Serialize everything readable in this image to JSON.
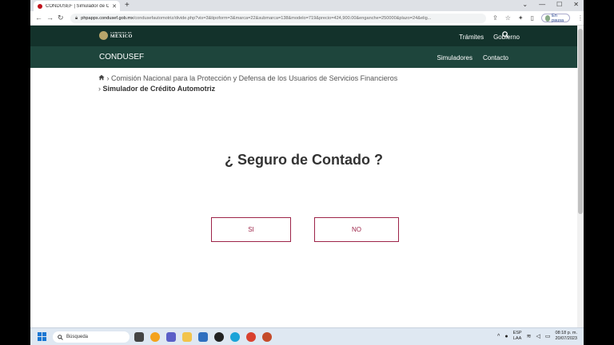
{
  "browser": {
    "tab_title": "CONDUSEF | Simulador de Cré",
    "tab_close": "✕",
    "new_tab": "+",
    "url_domain": "phpapps.condusef.gob.mx",
    "url_rest": "/condusefautomotriz/divide.php?vis=3&tipoform=3&marca=22&submarca=138&modelo=719&precio=424,900.00&enganche=250000&plazo=24&elig...",
    "incognito_label": "En pausa",
    "window_controls": [
      "⌄",
      "—",
      "☐",
      "✕"
    ]
  },
  "gov_header": {
    "logo_line1": "GOBIERNO DE",
    "logo_line2": "MÉXICO",
    "nav": [
      "Trámites",
      "Gobierno"
    ]
  },
  "site_header": {
    "brand": "CONDUSEF",
    "nav": [
      "Simuladores",
      "Contacto"
    ]
  },
  "breadcrumb": {
    "parent": "Comisión Nacional para la Protección y Defensa de los Usuarios de Servicios Financieros",
    "current": "Simulador de Crédito Automotriz"
  },
  "main": {
    "question": "¿ Seguro de Contado ?",
    "yes_label": "SI",
    "no_label": "NO"
  },
  "taskbar": {
    "search_placeholder": "Búsqueda",
    "lang_line1": "ESP",
    "lang_line2": "LAA",
    "time": "08:18 p. m.",
    "date": "20/07/2023"
  },
  "colors": {
    "gov_green": "#13322b",
    "site_green": "#1e453c",
    "accent": "#9d2449"
  }
}
